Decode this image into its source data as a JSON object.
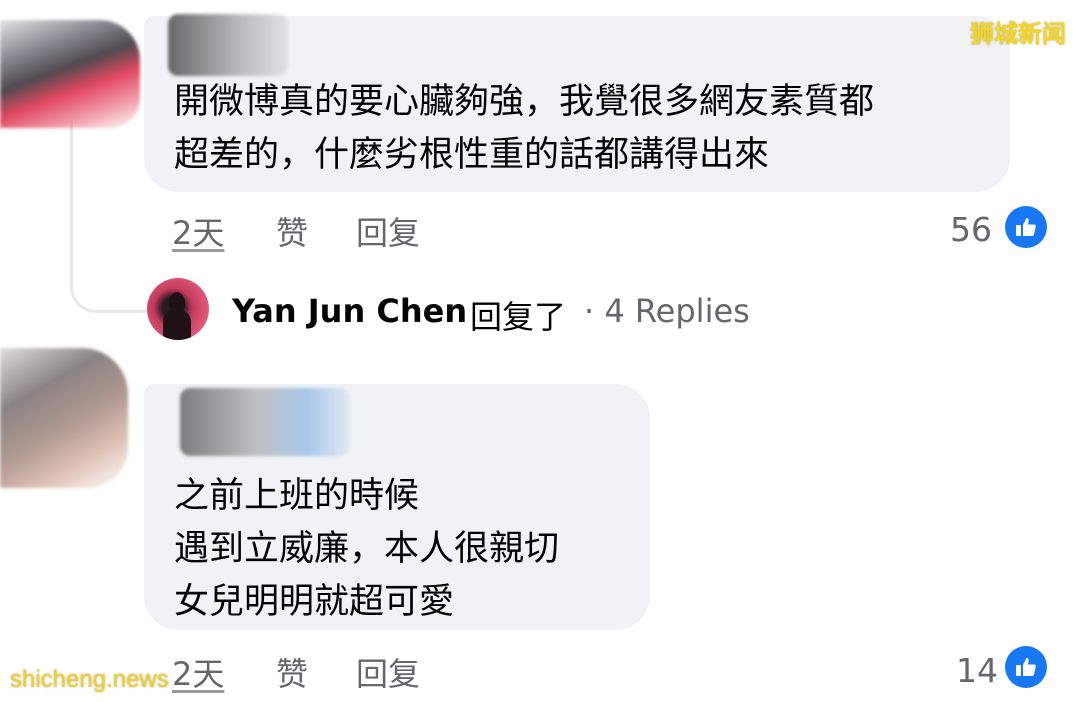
{
  "watermarks": {
    "top": "狮城新闻",
    "bottom": "shicheng.news"
  },
  "comment1": {
    "lines": [
      "開微博真的要心臟夠強，我覺很多網友素質都",
      "超差的，什麼劣根性重的話都講得出來"
    ],
    "time": "2天",
    "like_label": "赞",
    "reply_label": "回复",
    "reaction_count": "56",
    "reaction_icon": "thumbs-up-icon"
  },
  "reply_summary": {
    "name": "Yan Jun  Chen",
    "verb": "回复了",
    "count_text": "· 4 Replies"
  },
  "comment2": {
    "lines": [
      "之前上班的時候",
      "遇到立威廉，本人很親切",
      "女兒明明就超可愛"
    ],
    "time": "2天",
    "like_label": "赞",
    "reply_label": "回复",
    "reaction_count": "14",
    "reaction_icon": "thumbs-up-icon"
  },
  "colors": {
    "bubble": "#f0f2f5",
    "like_blue": "#1877f2",
    "secondary_text": "#65676b",
    "watermark": "#f6d61a"
  }
}
